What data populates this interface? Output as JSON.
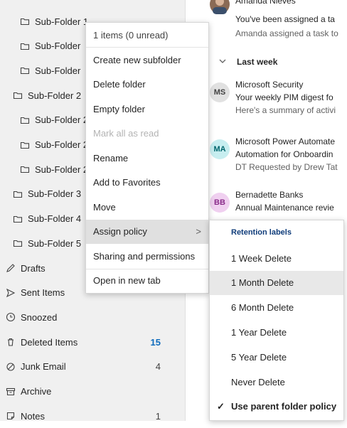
{
  "folders": [
    {
      "label": "Sub-Folder 1",
      "icon": "folder-icon",
      "indent": 2,
      "count": ""
    },
    {
      "label": "Sub-Folder",
      "icon": "folder-icon",
      "indent": 2,
      "count": ""
    },
    {
      "label": "Sub-Folder",
      "icon": "folder-icon",
      "indent": 2,
      "count": ""
    },
    {
      "label": "Sub-Folder 2",
      "icon": "folder-icon",
      "indent": 1,
      "count": ""
    },
    {
      "label": "Sub-Folder 2",
      "icon": "folder-icon",
      "indent": 2,
      "count": ""
    },
    {
      "label": "Sub-Folder 2",
      "icon": "folder-icon",
      "indent": 2,
      "count": ""
    },
    {
      "label": "Sub-Folder 2",
      "icon": "folder-icon",
      "indent": 2,
      "count": ""
    },
    {
      "label": "Sub-Folder 3",
      "icon": "folder-icon",
      "indent": 1,
      "count": ""
    },
    {
      "label": "Sub-Folder 4",
      "icon": "folder-icon",
      "indent": 1,
      "count": ""
    },
    {
      "label": "Sub-Folder 5",
      "icon": "folder-icon",
      "indent": 1,
      "count": ""
    },
    {
      "label": "Drafts",
      "icon": "pencil-icon",
      "indent": 0,
      "count": ""
    },
    {
      "label": "Sent Items",
      "icon": "send-icon",
      "indent": 0,
      "count": ""
    },
    {
      "label": "Snoozed",
      "icon": "clock-icon",
      "indent": 0,
      "count": ""
    },
    {
      "label": "Deleted Items",
      "icon": "trash-icon",
      "indent": 0,
      "count": "15",
      "bold": true
    },
    {
      "label": "Junk Email",
      "icon": "junk-icon",
      "indent": 0,
      "count": "4"
    },
    {
      "label": "Archive",
      "icon": "archive-icon",
      "indent": 0,
      "count": ""
    },
    {
      "label": "Notes",
      "icon": "note-icon",
      "indent": 0,
      "count": "1"
    }
  ],
  "context_menu": {
    "info": "1 items (0 unread)",
    "items": [
      {
        "label": "Create new subfolder",
        "disabled": false
      },
      {
        "label": "Delete folder",
        "disabled": false
      },
      {
        "label": "Empty folder",
        "disabled": false
      },
      {
        "label": "Mark all as read",
        "disabled": true
      },
      {
        "label": "Rename",
        "disabled": false
      },
      {
        "label": "Add to Favorites",
        "disabled": false
      },
      {
        "label": "Move",
        "disabled": false
      },
      {
        "label": "Assign policy",
        "disabled": false,
        "active": true,
        "arrow": ">"
      },
      {
        "label": "Sharing and permissions",
        "disabled": false
      },
      {
        "label": "Open in new tab",
        "disabled": false
      }
    ]
  },
  "submenu": {
    "header": "Retention labels",
    "items": [
      {
        "label": "1 Week Delete"
      },
      {
        "label": "1 Month Delete",
        "highlighted": true
      },
      {
        "label": "6 Month Delete"
      },
      {
        "label": "1 Year Delete"
      },
      {
        "label": "5 Year Delete"
      },
      {
        "label": "Never Delete"
      },
      {
        "label": "Use parent folder policy",
        "checked": true,
        "bold": true
      }
    ],
    "check_glyph": "✓"
  },
  "messages": {
    "top": {
      "sender": "Amanda Nieves",
      "subject": "You've been assigned a ta",
      "preview": "Amanda assigned a task to"
    },
    "group_label": "Last week",
    "items": [
      {
        "initials": "MS",
        "avatar_bg": "#e1e1e1",
        "avatar_fg": "#424242",
        "sender": "Microsoft Security",
        "subject": "Your weekly PIM digest fo",
        "preview": "Here's a summary of activi"
      },
      {
        "initials": "MA",
        "avatar_bg": "#c7eef0",
        "avatar_fg": "#00666d",
        "sender": "Microsoft Power Automate",
        "subject": "Automation for Onboardin",
        "preview": "DT Requested by Drew Tat"
      },
      {
        "initials": "BB",
        "avatar_bg": "#f0d0f0",
        "avatar_fg": "#8a2c8a",
        "sender": "Bernadette Banks",
        "subject": "Annual Maintenance revie",
        "preview": ""
      }
    ]
  },
  "colors": {
    "accent": "#0f6cbd",
    "pane_bg": "#f0f0f0",
    "menu_active": "#e0e0e0"
  }
}
